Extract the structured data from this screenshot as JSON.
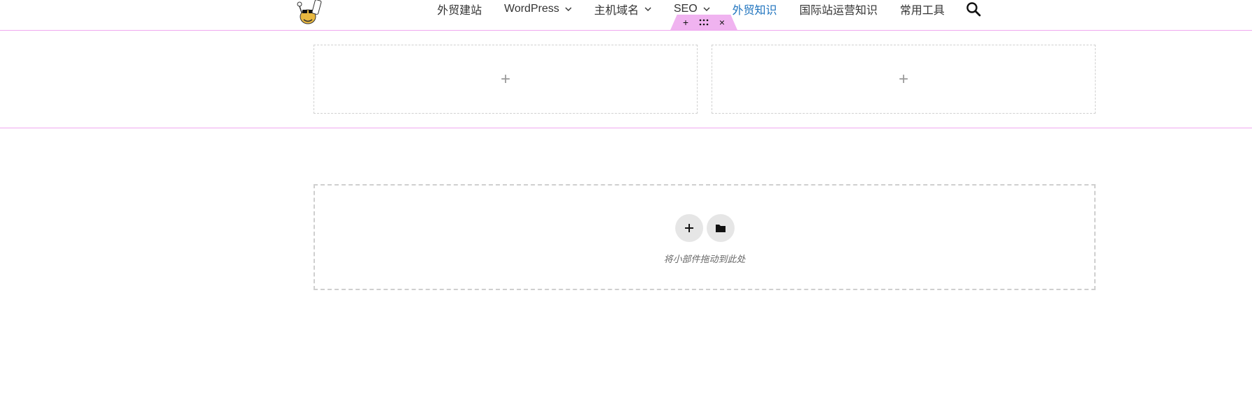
{
  "header": {
    "logo_name": "mascot-logo",
    "nav": [
      {
        "label": "外贸建站",
        "has_dropdown": false,
        "active": false
      },
      {
        "label": "WordPress",
        "has_dropdown": true,
        "active": false
      },
      {
        "label": "主机域名",
        "has_dropdown": true,
        "active": false
      },
      {
        "label": "SEO",
        "has_dropdown": true,
        "active": false
      },
      {
        "label": "外贸知识",
        "has_dropdown": false,
        "active": true
      },
      {
        "label": "国际站运营知识",
        "has_dropdown": false,
        "active": false
      },
      {
        "label": "常用工具",
        "has_dropdown": false,
        "active": false
      }
    ],
    "search_icon": "search-icon"
  },
  "section_handle": {
    "add_label": "+",
    "drag_icon": "drag-handle-icon",
    "close_label": "×",
    "color": "#f0b3f0"
  },
  "section": {
    "columns": [
      {
        "add_label": "+"
      },
      {
        "add_label": "+"
      }
    ]
  },
  "dropzone": {
    "add_label": "+",
    "template_icon": "folder-icon",
    "hint": "将小部件拖动到此处"
  },
  "colors": {
    "section_border": "#f0a8f0",
    "active_nav": "#1e73be",
    "dashed_border": "#cfcfcf"
  }
}
